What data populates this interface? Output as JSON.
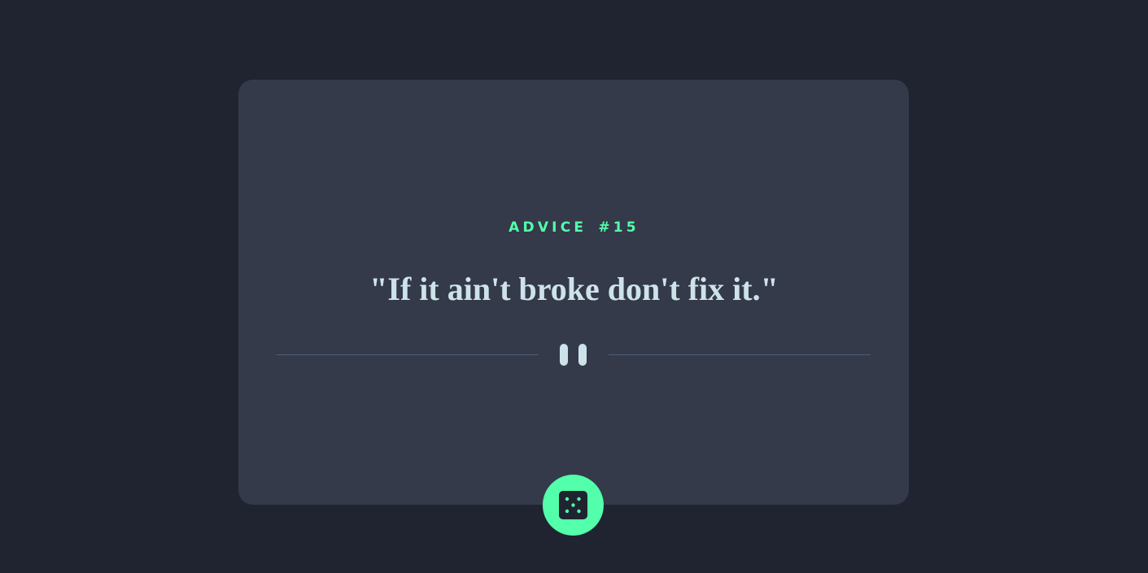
{
  "advice": {
    "label_prefix": "ADVICE",
    "number": "#15",
    "quote": "\"If it ain't broke don't fix it.\""
  },
  "icons": {
    "divider": "pause-icon",
    "button": "dice-icon"
  },
  "colors": {
    "background": "#1f2430",
    "card": "#343a4a",
    "accent": "#53ffaa",
    "quote_text": "#cee3e9",
    "divider_line": "#4f5d74"
  }
}
